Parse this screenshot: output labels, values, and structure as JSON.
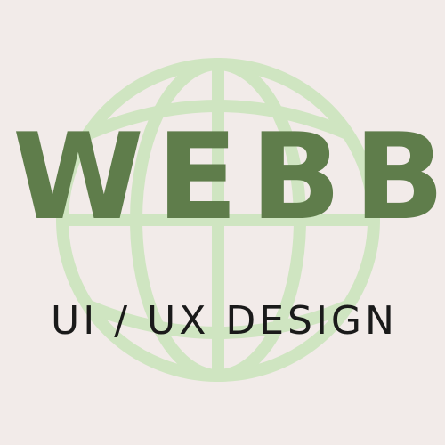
{
  "logo": {
    "brand_name": "WEBB",
    "tagline": "UI / UX DESIGN",
    "icon": "globe-icon"
  },
  "colors": {
    "background": "#f2ebe9",
    "brand_text": "#5f7d4b",
    "tagline_text": "#1a1a1a",
    "globe_stroke": "#cfe5c1"
  }
}
